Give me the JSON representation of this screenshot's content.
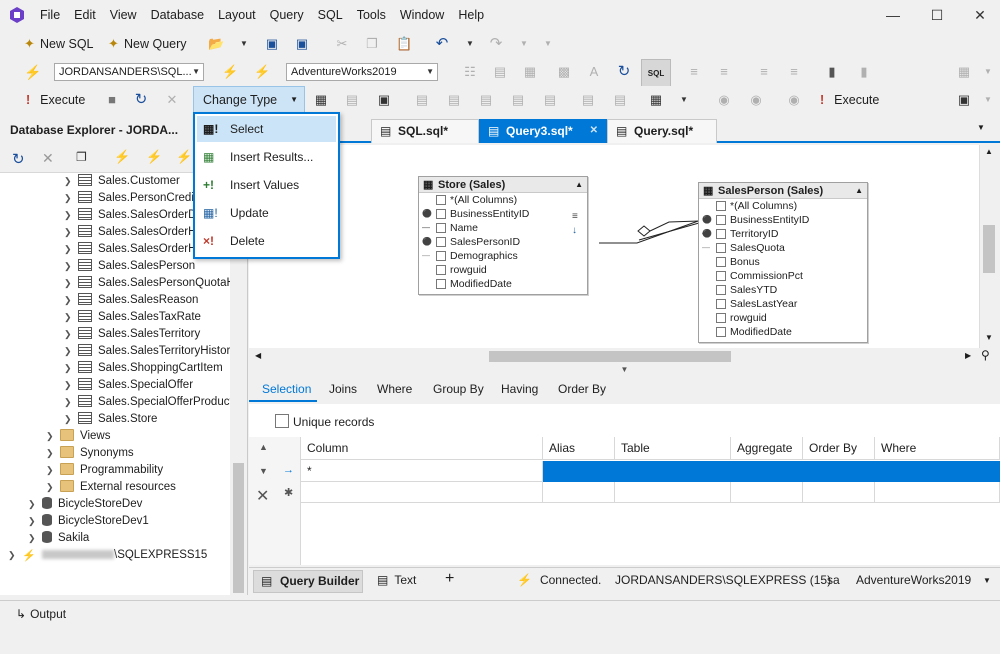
{
  "menu": [
    "File",
    "Edit",
    "View",
    "Database",
    "Layout",
    "Query",
    "SQL",
    "Tools",
    "Window",
    "Help"
  ],
  "toolbar1": {
    "new_sql": "New SQL",
    "new_query": "New Query"
  },
  "toolbar2": {
    "connection": "JORDANSANDERS\\SQL...",
    "database": "AdventureWorks2019"
  },
  "toolbar3": {
    "execute": "Execute",
    "change_type": "Change Type",
    "execute_right": "Execute"
  },
  "dropdown": [
    {
      "label": "Select",
      "icon": "select-icon"
    },
    {
      "label": "Insert Results...",
      "icon": "insert-results-icon"
    },
    {
      "label": "Insert Values",
      "icon": "insert-values-icon"
    },
    {
      "label": "Update",
      "icon": "update-icon"
    },
    {
      "label": "Delete",
      "icon": "delete-icon"
    }
  ],
  "db_explorer": {
    "title": "Database Explorer - JORDA...",
    "tables": [
      "Sales.Customer",
      "Sales.PersonCredit",
      "Sales.SalesOrderDe",
      "Sales.SalesOrderHe",
      "Sales.SalesOrderHe",
      "Sales.SalesPerson",
      "Sales.SalesPersonQuotaHi",
      "Sales.SalesReason",
      "Sales.SalesTaxRate",
      "Sales.SalesTerritory",
      "Sales.SalesTerritoryHistory",
      "Sales.ShoppingCartItem",
      "Sales.SpecialOffer",
      "Sales.SpecialOfferProduct",
      "Sales.Store"
    ],
    "folders": [
      "Views",
      "Synonyms",
      "Programmability",
      "External resources"
    ],
    "databases": [
      "BicycleStoreDev",
      "BicycleStoreDev1",
      "Sakila"
    ],
    "server": "\\SQLEXPRESS15"
  },
  "tabs": [
    {
      "label": "SQL.sql*"
    },
    {
      "label": "Query3.sql*"
    },
    {
      "label": "Query.sql*"
    }
  ],
  "store_entity": {
    "title": "Store (Sales)",
    "fields": [
      "*(All Columns)",
      "BusinessEntityID",
      "Name",
      "SalesPersonID",
      "Demographics",
      "rowguid",
      "ModifiedDate"
    ]
  },
  "salesperson_entity": {
    "title": "SalesPerson (Sales)",
    "fields": [
      "*(All Columns)",
      "BusinessEntityID",
      "TerritoryID",
      "SalesQuota",
      "Bonus",
      "CommissionPct",
      "SalesYTD",
      "SalesLastYear",
      "rowguid",
      "ModifiedDate"
    ]
  },
  "lower_tabs": [
    "Selection",
    "Joins",
    "Where",
    "Group By",
    "Having",
    "Order By"
  ],
  "unique_records": "Unique records",
  "grid": {
    "columns": [
      "Column",
      "Alias",
      "Table",
      "Aggregate",
      "Order By",
      "Where"
    ],
    "row1": "*"
  },
  "status": {
    "query_builder": "Query Builder",
    "text": "Text",
    "plus": "+",
    "connected": "Connected.",
    "server": "JORDANSANDERS\\SQLEXPRESS (15)",
    "user": "sa",
    "db": "AdventureWorks2019"
  },
  "output": "Output",
  "colors": {
    "accent": "#0078d7",
    "highlight": "#cce4f7"
  }
}
